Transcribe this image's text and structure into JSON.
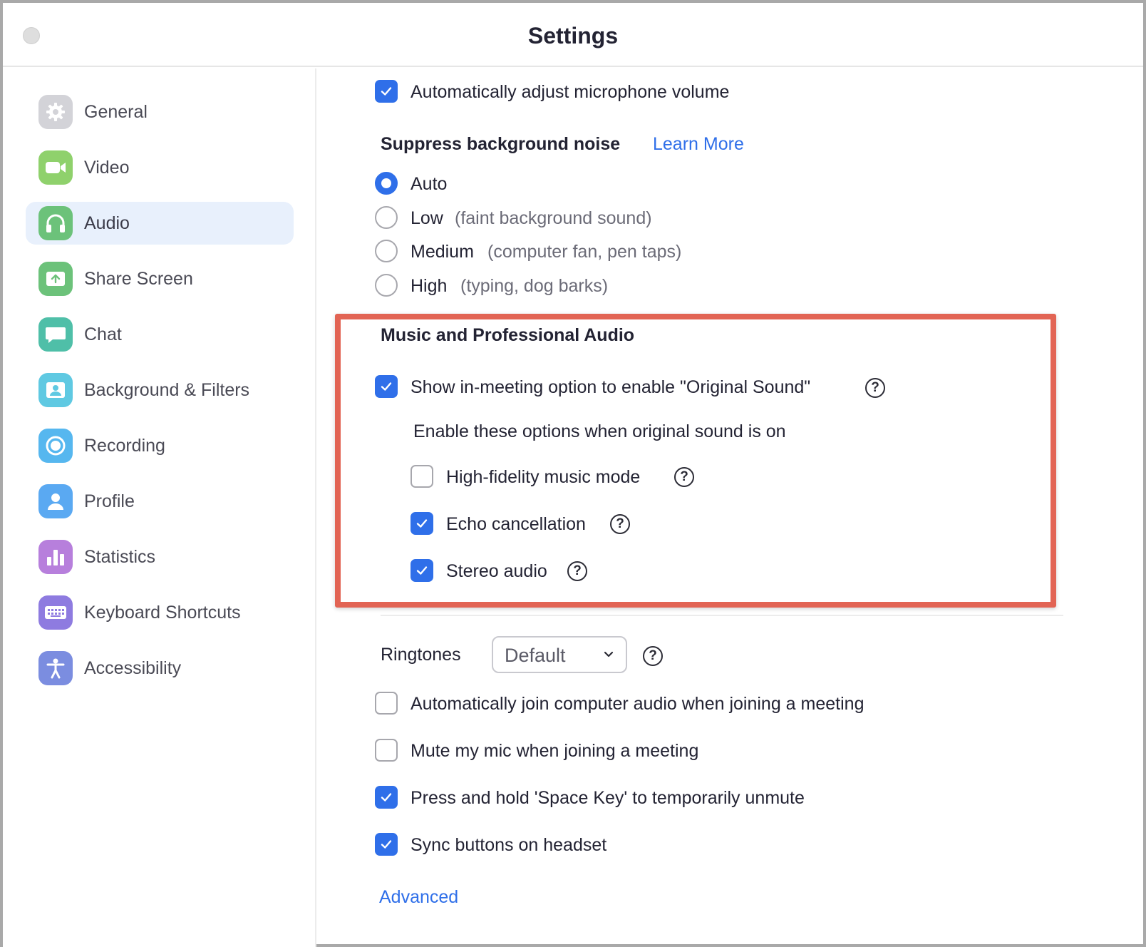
{
  "window": {
    "title": "Settings"
  },
  "sidebar": {
    "items": [
      {
        "label": "General",
        "icon": "gear-icon",
        "color": "#d3d3d8"
      },
      {
        "label": "Video",
        "icon": "video-camera-icon",
        "color": "#8fd16c"
      },
      {
        "label": "Audio",
        "icon": "headphones-icon",
        "color": "#6cc27a",
        "active": true
      },
      {
        "label": "Share Screen",
        "icon": "share-screen-icon",
        "color": "#6cc27a"
      },
      {
        "label": "Chat",
        "icon": "chat-bubble-icon",
        "color": "#4fbfa8"
      },
      {
        "label": "Background & Filters",
        "icon": "background-icon",
        "color": "#5fc9e2"
      },
      {
        "label": "Recording",
        "icon": "recording-icon",
        "color": "#56b7ef"
      },
      {
        "label": "Profile",
        "icon": "profile-icon",
        "color": "#5aa9f2"
      },
      {
        "label": "Statistics",
        "icon": "statistics-icon",
        "color": "#b77fdc"
      },
      {
        "label": "Keyboard Shortcuts",
        "icon": "keyboard-icon",
        "color": "#8e7be0"
      },
      {
        "label": "Accessibility",
        "icon": "accessibility-icon",
        "color": "#7b8de0"
      }
    ]
  },
  "audio": {
    "auto_adjust_mic": {
      "label": "Automatically adjust microphone volume",
      "checked": true
    },
    "suppress": {
      "heading": "Suppress background noise",
      "learn_more": "Learn More",
      "options": [
        {
          "label": "Auto",
          "hint": "",
          "checked": true
        },
        {
          "label": "Low",
          "hint": "(faint background sound)",
          "checked": false
        },
        {
          "label": "Medium",
          "hint": "(computer fan, pen taps)",
          "checked": false
        },
        {
          "label": "High",
          "hint": "(typing, dog barks)",
          "checked": false
        }
      ]
    },
    "music": {
      "heading": "Music and Professional Audio",
      "original_sound": {
        "label": "Show in-meeting option to enable \"Original Sound\"",
        "checked": true
      },
      "sub_heading": "Enable these options when original sound is on",
      "high_fidelity": {
        "label": "High-fidelity music mode",
        "checked": false
      },
      "echo": {
        "label": "Echo cancellation",
        "checked": true
      },
      "stereo": {
        "label": "Stereo audio",
        "checked": true
      }
    },
    "ringtones": {
      "label": "Ringtones",
      "value": "Default"
    },
    "auto_join": {
      "label": "Automatically join computer audio when joining a meeting",
      "checked": false
    },
    "mute_on_join": {
      "label": "Mute my mic when joining a meeting",
      "checked": false
    },
    "space_unmute": {
      "label": "Press and hold 'Space Key' to temporarily unmute",
      "checked": true
    },
    "sync_headset": {
      "label": "Sync buttons on headset",
      "checked": true
    },
    "advanced": "Advanced"
  },
  "colors": {
    "accent": "#2f6fe9",
    "highlight_border": "#e26454",
    "active_nav_bg": "#e8f0fc"
  },
  "help_glyph": "?"
}
